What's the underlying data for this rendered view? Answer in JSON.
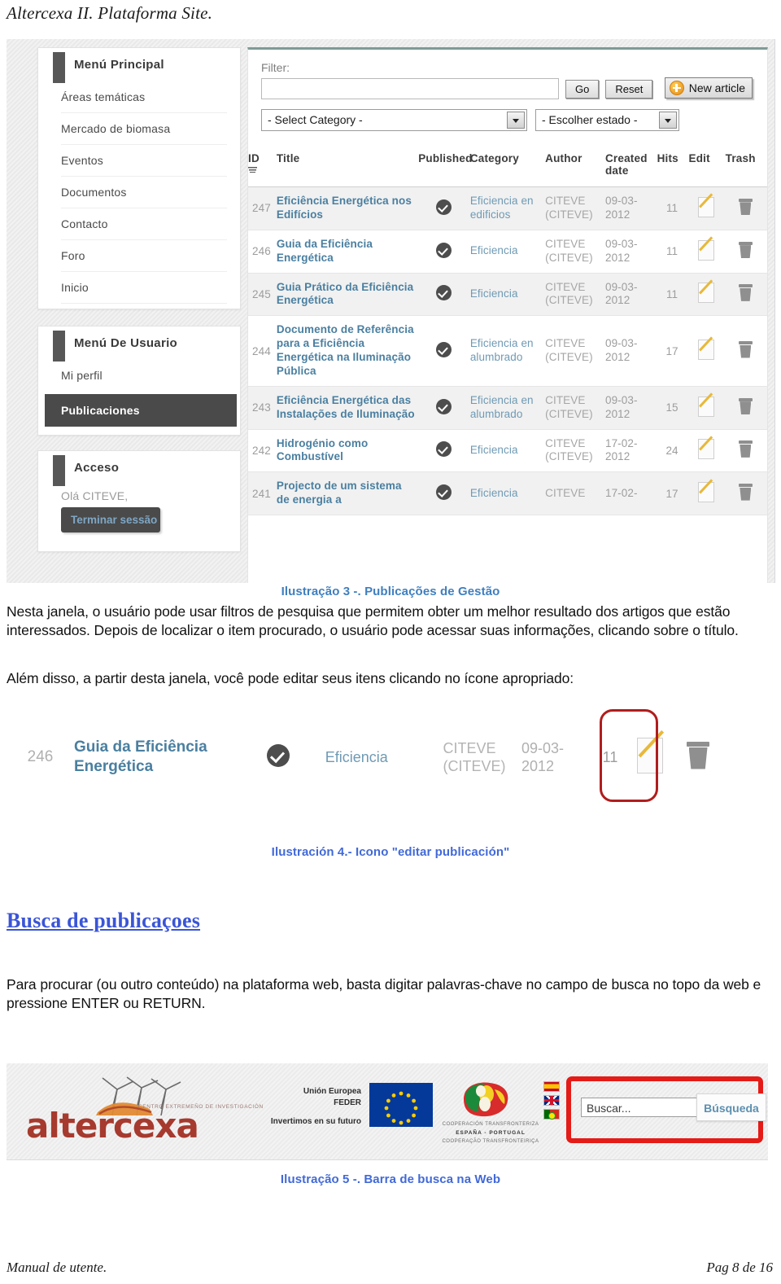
{
  "page": {
    "running_head": "Altercexa II. Plataforma Site.",
    "footer_left": "Manual de utente.",
    "footer_right": "Pag  8 de 16"
  },
  "figure3": {
    "sidebar": {
      "main_menu": {
        "title": "Menú Principal",
        "items": [
          "Áreas temáticas",
          "Mercado de biomasa",
          "Eventos",
          "Documentos",
          "Contacto",
          "Foro",
          "Inicio"
        ]
      },
      "user_menu": {
        "title": "Menú De Usuario",
        "items": [
          "Mi perfil"
        ],
        "active_item": "Publicaciones"
      },
      "access": {
        "title": "Acceso",
        "greeting": "Olá CITEVE,",
        "logout_label": "Terminar sessão"
      }
    },
    "toolbar": {
      "filter_label": "Filter:",
      "filter_value": "",
      "go_label": "Go",
      "reset_label": "Reset",
      "new_article_label": "New article",
      "category_select": "- Select Category -",
      "state_select": "- Escolher estado -"
    },
    "table": {
      "headers": [
        "ID",
        "Title",
        "Published",
        "Category",
        "Author",
        "Created date",
        "Hits",
        "Edit",
        "Trash"
      ],
      "rows": [
        {
          "id": "247",
          "title": "Eficiência Energética nos Edifícios",
          "published": true,
          "category": "Eficiencia en edificios",
          "author": "CITEVE (CITEVE)",
          "date": "09-03-2012",
          "hits": "11"
        },
        {
          "id": "246",
          "title": "Guia da Eficiência Energética",
          "published": true,
          "category": "Eficiencia",
          "author": "CITEVE (CITEVE)",
          "date": "09-03-2012",
          "hits": "11"
        },
        {
          "id": "245",
          "title": "Guia Prático da Eficiência Energética",
          "published": true,
          "category": "Eficiencia",
          "author": "CITEVE (CITEVE)",
          "date": "09-03-2012",
          "hits": "11"
        },
        {
          "id": "244",
          "title": "Documento de Referência para a Eficiência Energética na Iluminação Pública",
          "published": true,
          "category": "Eficiencia en alumbrado",
          "author": "CITEVE (CITEVE)",
          "date": "09-03-2012",
          "hits": "17"
        },
        {
          "id": "243",
          "title": "Eficiência Energética das Instalações de Iluminação",
          "published": true,
          "category": "Eficiencia en alumbrado",
          "author": "CITEVE (CITEVE)",
          "date": "09-03-2012",
          "hits": "15"
        },
        {
          "id": "242",
          "title": "Hidrogénio como Combustível",
          "published": true,
          "category": "Eficiencia",
          "author": "CITEVE (CITEVE)",
          "date": "17-02-2012",
          "hits": "24"
        },
        {
          "id": "241",
          "title": "Projecto de um sistema de energia a",
          "published": true,
          "category": "Eficiencia",
          "author": "CITEVE",
          "date": "17-02-",
          "hits": "17"
        }
      ]
    },
    "caption": "Ilustração 3 -. Publicações de Gestão"
  },
  "body": {
    "paragraph_1": "Nesta janela, o usuário pode usar filtros de pesquisa que permitem obter um melhor resultado dos artigos que estão interessados. Depois de localizar o item procurado, o usuário pode acessar suas informações, clicando sobre o título.",
    "paragraph_2": "Além disso, a partir desta janela, você pode editar seus itens clicando no ícone apropriado:",
    "section_heading": "Busca de publicaçoes",
    "paragraph_3": "Para procurar (ou outro conteúdo) na plataforma web, basta digitar palavras-chave no campo de busca no topo da web e pressione ENTER ou RETURN."
  },
  "figure4": {
    "row": {
      "id": "246",
      "title": "Guia da Eficiência Energética",
      "published": true,
      "category": "Eficiencia",
      "author": "CITEVE (CITEVE)",
      "date": "09-03-2012",
      "hits": "11"
    },
    "highlight_color": "#b01d1d",
    "caption": "Ilustración 4.- Icono \"editar publicación\""
  },
  "figure5": {
    "altercexa_logo": {
      "word": "altercexa",
      "tagline": "CENTRO EXTREMEÑO DE INVESTIGACIÓN"
    },
    "eu_logo": {
      "line1": "Unión Europea",
      "line2": "FEDER",
      "line3": "Invertimos en su futuro"
    },
    "coop_logo": {
      "line1": "COOPERACIÓN TRANSFRONTERIZA",
      "line2": "ESPAÑA - PORTUGAL",
      "line3": "COOPERAÇÃO TRANSFRONTEIRIÇA"
    },
    "languages": [
      "es",
      "en",
      "pt"
    ],
    "search": {
      "placeholder": "Buscar...",
      "value": "",
      "button_label": "Búsqueda"
    },
    "highlight_color": "#e41b17",
    "caption": "Ilustração 5 -. Barra de busca na Web"
  }
}
